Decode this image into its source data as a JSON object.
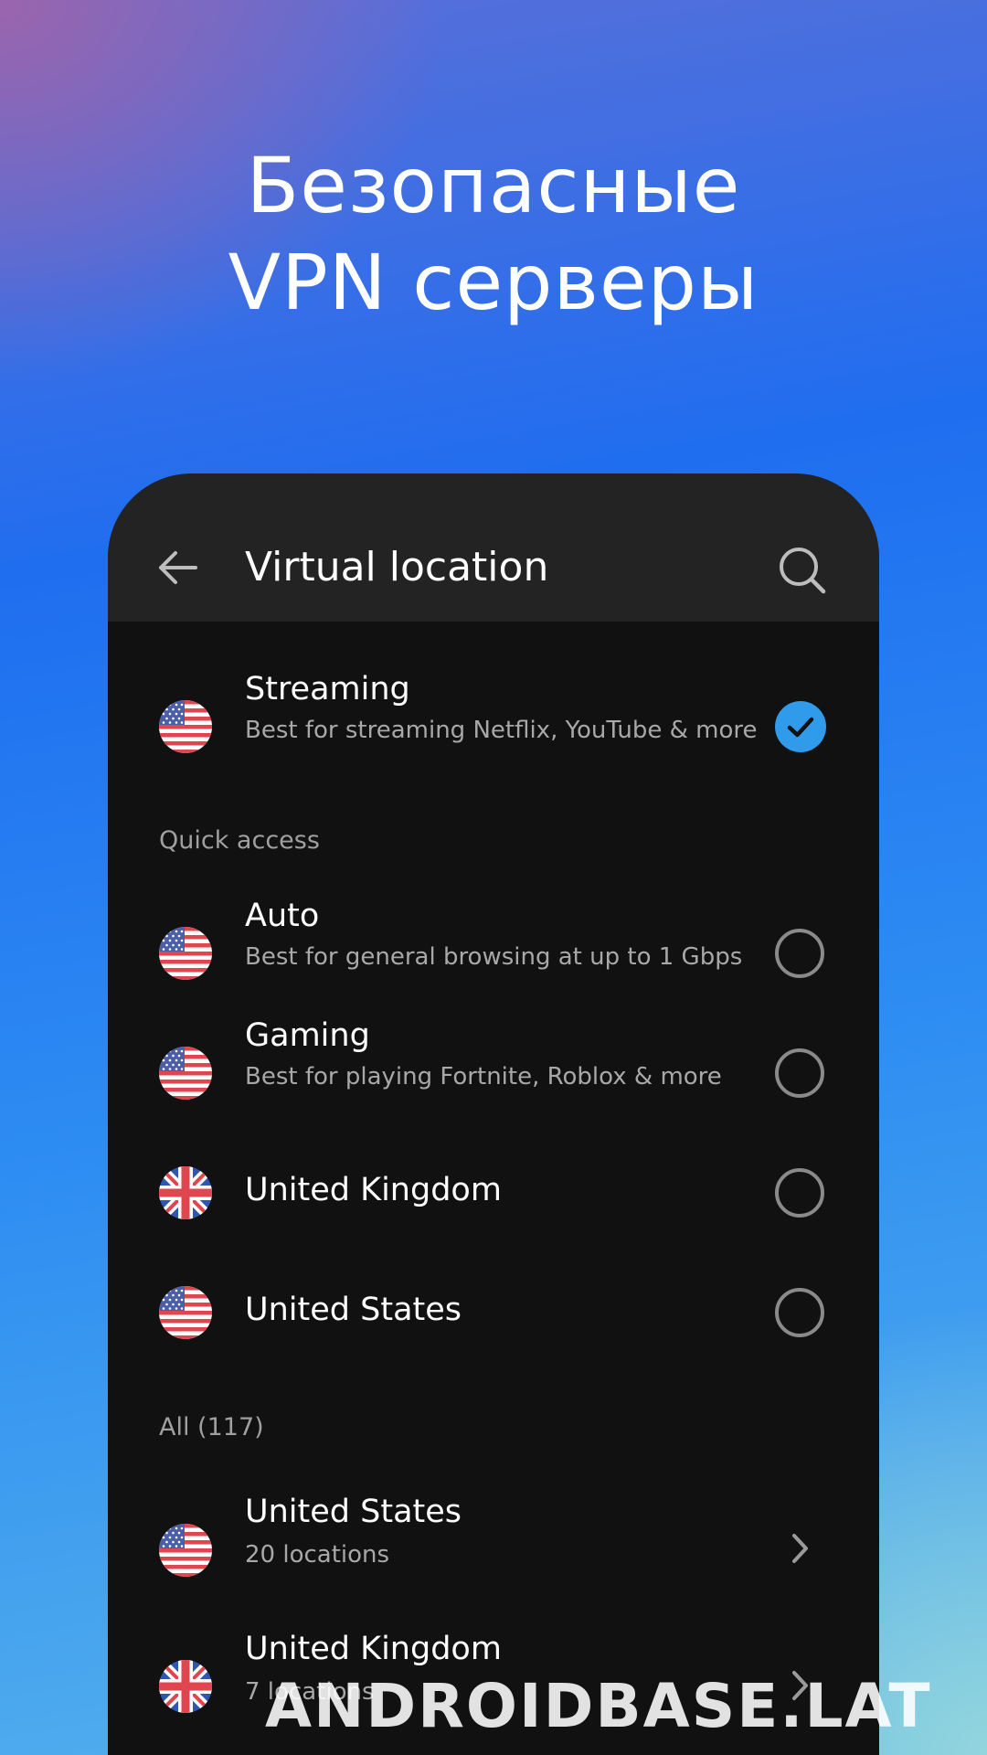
{
  "headline": {
    "line1": "Безопасные",
    "line2": "VPN серверы"
  },
  "app_bar": {
    "back_icon": "arrow-back-icon",
    "title": "Virtual location",
    "search_icon": "search-icon"
  },
  "selected": {
    "flag": "us-flag-icon",
    "title": "Streaming",
    "subtitle": "Best for streaming Netflix, YouTube & more",
    "checked": true
  },
  "quick_access": {
    "label": "Quick access",
    "items": [
      {
        "flag": "us-flag-icon",
        "title": "Auto",
        "subtitle": "Best for general browsing at up to 1 Gbps",
        "checked": false
      },
      {
        "flag": "us-flag-icon",
        "title": "Gaming",
        "subtitle": "Best for playing Fortnite, Roblox & more",
        "checked": false
      },
      {
        "flag": "uk-flag-icon",
        "title": "United Kingdom",
        "checked": false
      },
      {
        "flag": "us-flag-icon",
        "title": "United States",
        "checked": false
      }
    ]
  },
  "all": {
    "label": "All (117)",
    "items": [
      {
        "flag": "us-flag-icon",
        "title": "United States",
        "subtitle": "20 locations"
      },
      {
        "flag": "uk-flag-icon",
        "title": "United Kingdom",
        "subtitle": "7 locations"
      }
    ]
  },
  "watermark": "ANDROIDBASE.LAT",
  "colors": {
    "accent": "#2f9bea",
    "panel": "#111111",
    "app_bar": "#232323",
    "secondary_text": "#a8a8a8"
  }
}
